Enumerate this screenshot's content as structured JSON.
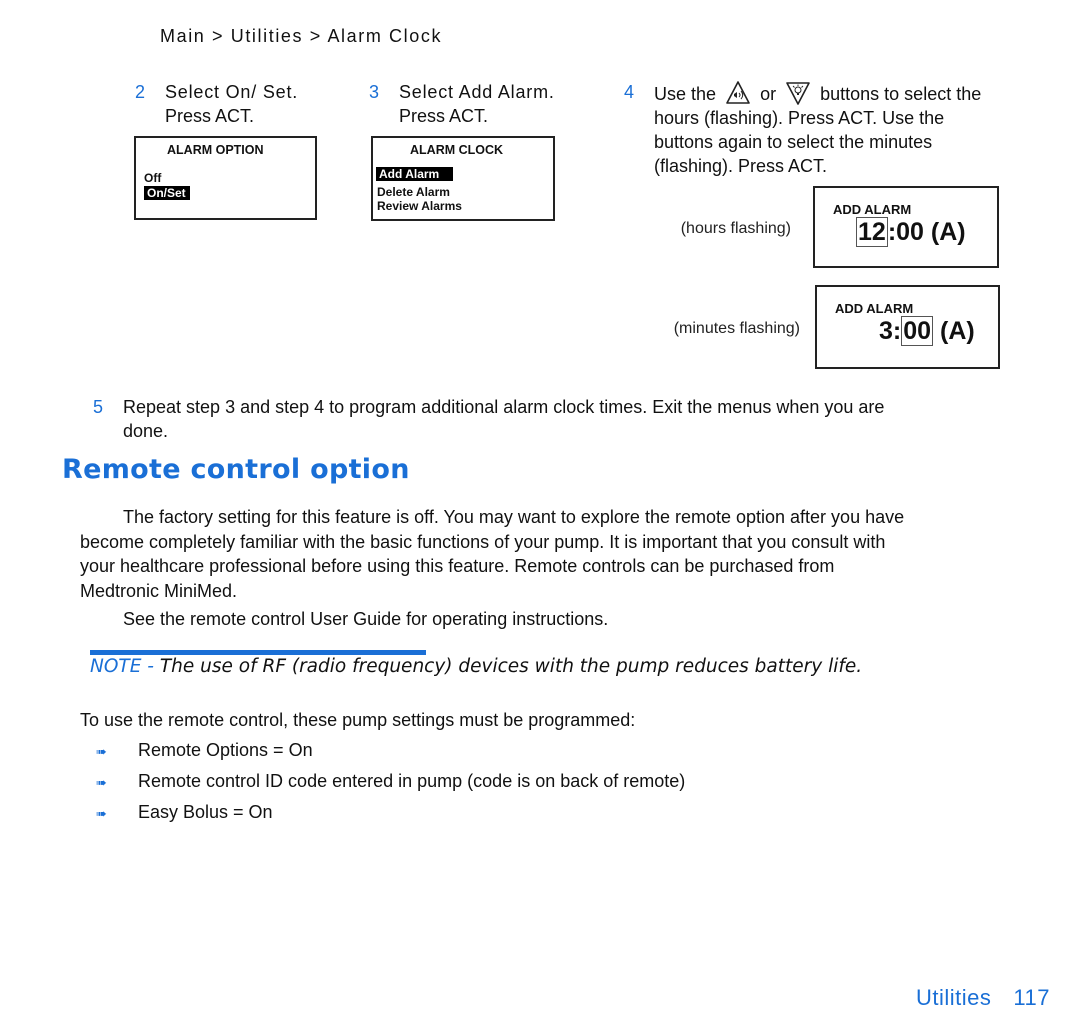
{
  "breadcrumb": "Main > Utilities > Alarm Clock",
  "steps": [
    {
      "number": "2",
      "line1": "Select On/ Set.",
      "line2": "Press ACT."
    },
    {
      "number": "3",
      "line1": "Select Add Alarm.",
      "line2": "Press ACT."
    },
    {
      "number": "4",
      "part1": "Use the",
      "part2": "or",
      "part3": "buttons to select the",
      "line2": "hours (flashing). Press ACT. Use the",
      "line3": "buttons again to select the minutes",
      "line4": "(flashing). Press ACT.",
      "icons": [
        "up-button-icon",
        "down-button-icon"
      ]
    },
    {
      "number": "5",
      "line1": "Repeat step 3 and step 4 to program additional alarm clock times. Exit the menus when you are",
      "line2": "done."
    }
  ],
  "screens": {
    "alarm_option": {
      "title": "ALARM OPTION",
      "items": [
        "Off",
        "On/Set"
      ],
      "selected": "On/Set"
    },
    "alarm_clock": {
      "title": "ALARM CLOCK",
      "items": [
        "Add Alarm",
        "Delete Alarm",
        "Review Alarms"
      ],
      "selected": "Add Alarm"
    },
    "add_alarm_hours": {
      "label": "(hours flashing)",
      "title": "ADD ALARM",
      "hours": "12",
      "sep": ":",
      "minutes": "00",
      "suffix": "(A)"
    },
    "add_alarm_minutes": {
      "label": "(minutes flashing)",
      "title": "ADD ALARM",
      "hours": "3",
      "sep": ":",
      "minutes": "00",
      "suffix": "(A)"
    }
  },
  "section": {
    "heading": "Remote control option",
    "paragraph1": [
      "The factory setting for this feature is off. You may want to explore the remote option after you have",
      "become completely familiar with the basic functions of your pump. It is important that you consult with",
      "your healthcare professional before using this feature. Remote controls can be purchased from",
      "Medtronic MiniMed."
    ],
    "paragraph2": "See the remote control User Guide for operating instructions.",
    "note_label": "NOTE -",
    "note_text": "The use of RF (radio frequency) devices with the pump reduces battery life.",
    "intro": "To use the remote control, these pump settings must be programmed:",
    "bullets": [
      "Remote Options = On",
      "Remote control ID code entered in pump (code is on back of remote)",
      "Easy Bolus = On"
    ]
  },
  "footer": {
    "section": "Utilities",
    "page": "117"
  },
  "colors": {
    "accent": "#1a6fd6",
    "text": "#111111"
  }
}
